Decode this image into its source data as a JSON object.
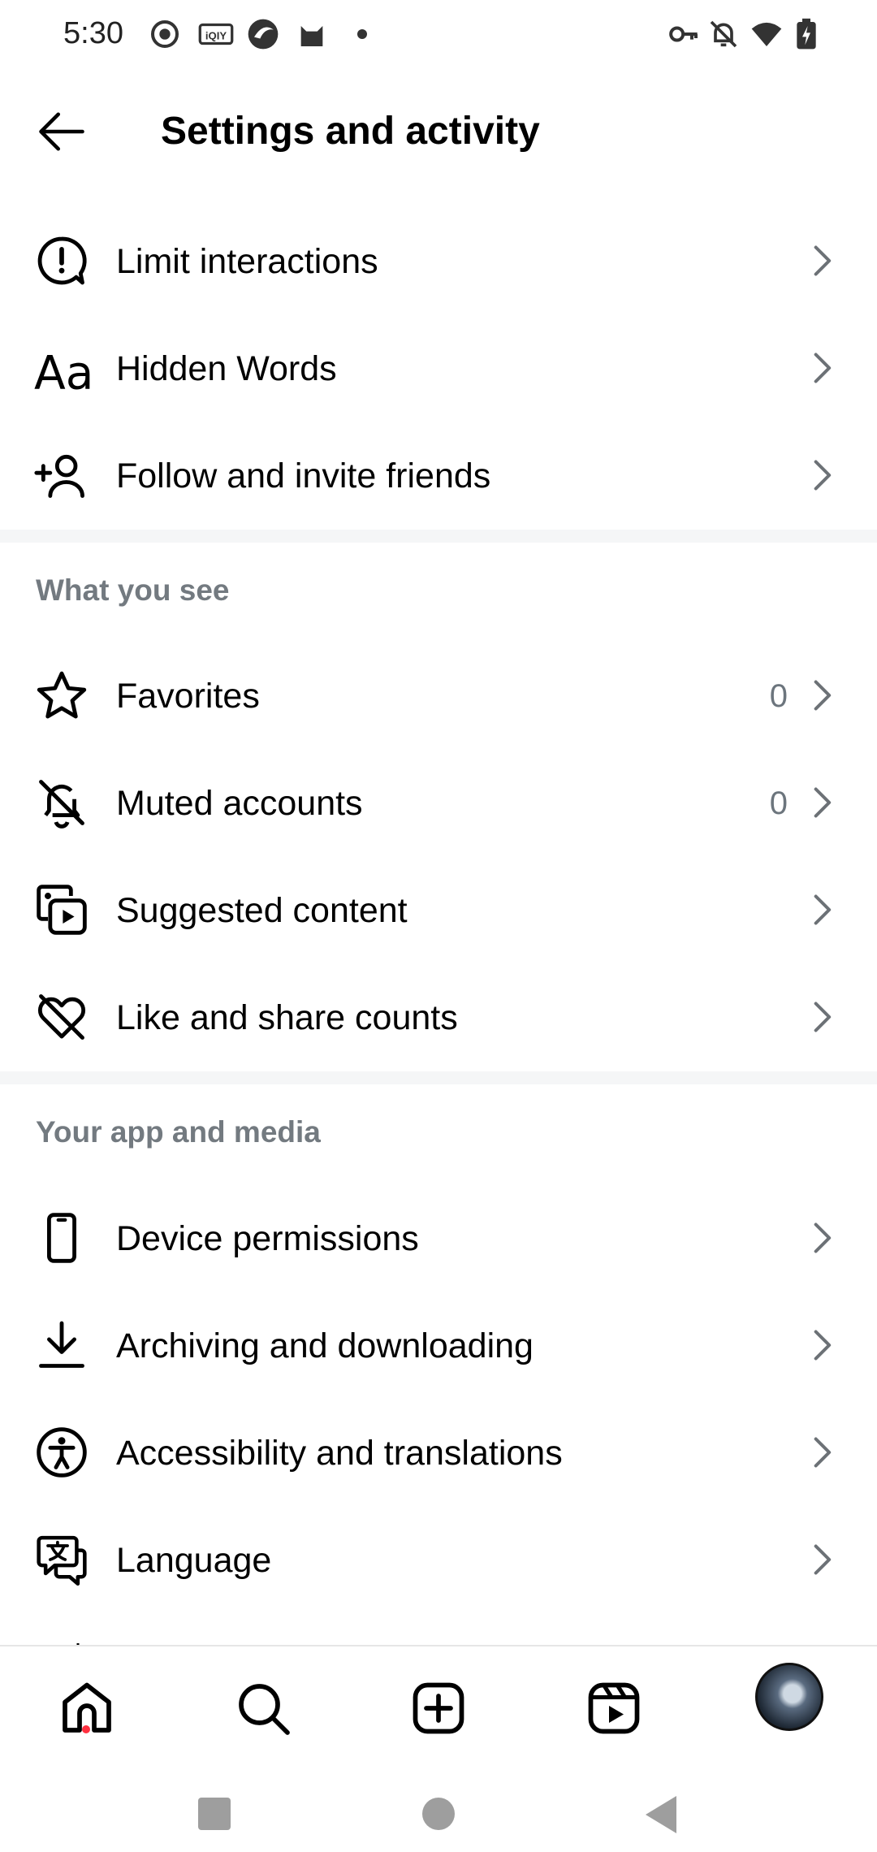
{
  "status_bar": {
    "time": "5:30",
    "left_icons": [
      "record-icon",
      "iqiyi-icon",
      "browser-icon",
      "cat-app-icon",
      "dot-icon"
    ],
    "right_icons": [
      "vpn-key-icon",
      "bell-off-icon",
      "wifi-icon",
      "battery-charging-icon"
    ]
  },
  "header": {
    "title": "Settings and activity",
    "back_icon": "arrow-left-icon"
  },
  "groups": [
    {
      "section": "",
      "items": [
        {
          "label": "Limit interactions",
          "icon": "limit-interactions-icon",
          "count": ""
        },
        {
          "label": "Hidden Words",
          "icon": "text-aa-icon",
          "count": ""
        },
        {
          "label": "Follow and invite friends",
          "icon": "add-person-icon",
          "count": ""
        }
      ]
    },
    {
      "section": "What you see",
      "items": [
        {
          "label": "Favorites",
          "icon": "star-icon",
          "count": "0"
        },
        {
          "label": "Muted accounts",
          "icon": "bell-slash-icon",
          "count": "0"
        },
        {
          "label": "Suggested content",
          "icon": "suggested-media-icon",
          "count": ""
        },
        {
          "label": "Like and share counts",
          "icon": "heart-slash-icon",
          "count": ""
        }
      ]
    },
    {
      "section": "Your app and media",
      "items": [
        {
          "label": "Device permissions",
          "icon": "phone-icon",
          "count": ""
        },
        {
          "label": "Archiving and downloading",
          "icon": "download-icon",
          "count": ""
        },
        {
          "label": "Accessibility and translations",
          "icon": "accessibility-icon",
          "count": ""
        },
        {
          "label": "Language",
          "icon": "translate-chat-icon",
          "count": ""
        }
      ]
    }
  ],
  "bottom_nav": [
    {
      "name": "home",
      "icon": "home-icon"
    },
    {
      "name": "search",
      "icon": "search-icon"
    },
    {
      "name": "create",
      "icon": "plus-square-icon"
    },
    {
      "name": "reels",
      "icon": "reels-icon"
    },
    {
      "name": "profile",
      "icon": "avatar"
    }
  ],
  "colors": {
    "text": "#000000",
    "secondary_text": "#737a80",
    "divider": "#f5f6f7",
    "notification_dot": "#ff3040"
  }
}
